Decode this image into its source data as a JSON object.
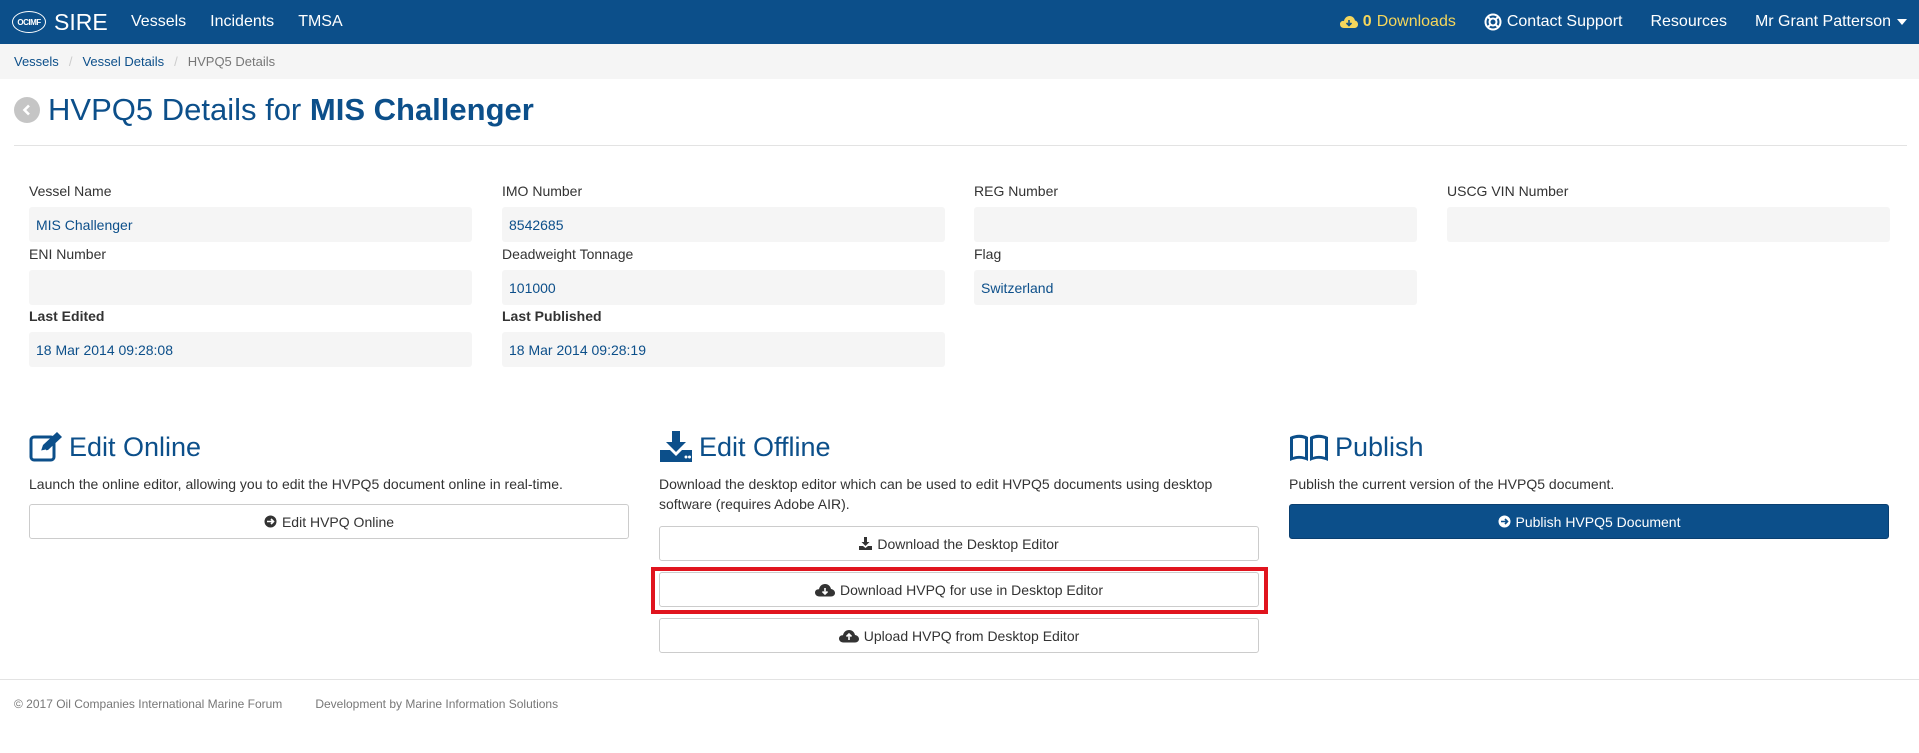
{
  "navbar": {
    "logo_text": "OCIMF",
    "brand": "SIRE",
    "links": [
      "Vessels",
      "Incidents",
      "TMSA"
    ],
    "downloads_count": "0",
    "downloads_label": "Downloads",
    "contact_support": "Contact Support",
    "resources": "Resources",
    "user": "Mr Grant Patterson"
  },
  "breadcrumb": [
    "Vessels",
    "Vessel Details",
    "HVPQ5 Details"
  ],
  "page": {
    "title_prefix": "HVPQ5 Details for",
    "vessel_name": "MIS Challenger"
  },
  "fields": {
    "vessel_name": {
      "label": "Vessel Name",
      "value": "MIS Challenger"
    },
    "imo_number": {
      "label": "IMO Number",
      "value": "8542685"
    },
    "reg_number": {
      "label": "REG Number",
      "value": ""
    },
    "uscg_vin": {
      "label": "USCG VIN Number",
      "value": ""
    },
    "eni_number": {
      "label": "ENI Number",
      "value": ""
    },
    "deadweight": {
      "label": "Deadweight Tonnage",
      "value": "101000"
    },
    "flag": {
      "label": "Flag",
      "value": "Switzerland"
    },
    "last_edited": {
      "label": "Last Edited",
      "value": "18 Mar 2014 09:28:08"
    },
    "last_published": {
      "label": "Last Published",
      "value": "18 Mar 2014 09:28:19"
    }
  },
  "sections": {
    "edit_online": {
      "title": "Edit Online",
      "desc": "Launch the online editor, allowing you to edit the HVPQ5 document online in real-time.",
      "button": "Edit HVPQ Online"
    },
    "edit_offline": {
      "title": "Edit Offline",
      "desc_line1": "Download the desktop editor which can be used to edit HVPQ5 documents using desktop",
      "desc_line2": "software (requires Adobe AIR).",
      "btn_desktop": "Download the Desktop Editor",
      "btn_download": "Download HVPQ for use in Desktop Editor",
      "btn_upload": "Upload HVPQ from Desktop Editor"
    },
    "publish": {
      "title": "Publish",
      "desc": "Publish the current version of the HVPQ5 document.",
      "button": "Publish HVPQ5 Document"
    }
  },
  "footer": {
    "copyright": "© 2017 Oil Companies International Marine Forum",
    "dev": "Development by Marine Information Solutions"
  },
  "colors": {
    "brand": "#0c4f8a",
    "highlight": "#e0141e",
    "downloads": "#f5d65c"
  }
}
